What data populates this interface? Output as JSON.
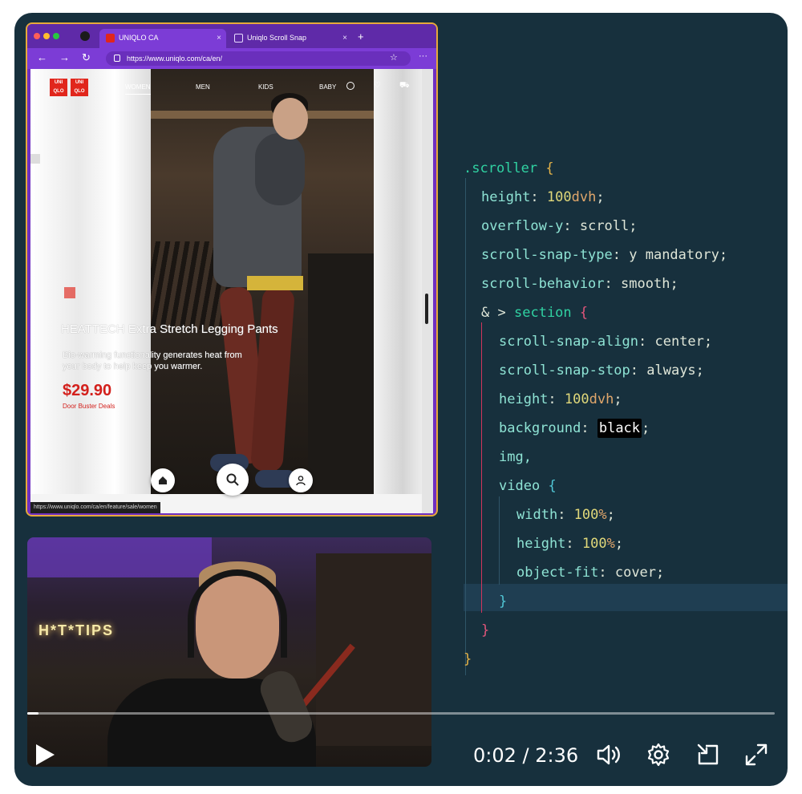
{
  "video": {
    "current_time": "0:02",
    "duration": "2:36",
    "time_separator": "/",
    "progress_fraction": 0.015
  },
  "browser": {
    "tabs": [
      {
        "label": "UNIQLO CA",
        "active": true
      },
      {
        "label": "Uniqlo Scroll Snap",
        "active": false
      }
    ],
    "url": "https://www.uniqlo.com/ca/en/",
    "status_url": "https://www.uniqlo.com/ca/en/feature/sale/women"
  },
  "site": {
    "logo_top": "UNI",
    "logo_bottom": "QLO",
    "nav": [
      "WOMEN",
      "MEN",
      "KIDS",
      "BABY"
    ],
    "product_title": "HEATTECH Extra Stretch Legging Pants",
    "product_desc": "Bio-warming functionality generates heat from your body to help keep you warmer.",
    "price": "$29.90",
    "deal": "Door Buster Deals"
  },
  "webcam": {
    "neon_sign": "H*T*TIPS"
  },
  "code": {
    "l1_sel": ".scroller",
    "l1_brace": "{",
    "l2_prop": "height",
    "l2_num": "100",
    "l2_unit": "dvh",
    "l3_prop": "overflow-y",
    "l3_val": "scroll",
    "l4_prop": "scroll-snap-type",
    "l4_val": "y mandatory",
    "l5_prop": "scroll-behavior",
    "l5_val": "smooth",
    "l6_amp": "&",
    "l6_gt": ">",
    "l6_sel": "section",
    "l6_brace": "{",
    "l7_prop": "scroll-snap-align",
    "l7_val": "center",
    "l8_prop": "scroll-snap-stop",
    "l8_val": "always",
    "l9_prop": "height",
    "l9_num": "100",
    "l9_unit": "dvh",
    "l10_prop": "background",
    "l10_val": "black",
    "l11_sel": "img,",
    "l12_sel": "video",
    "l12_brace": "{",
    "l13_prop": "width",
    "l13_num": "100",
    "l13_unit": "%",
    "l14_prop": "height",
    "l14_num": "100",
    "l14_unit": "%",
    "l15_prop": "object-fit",
    "l15_val": "cover",
    "l16_brace": "}",
    "l17_brace": "}",
    "l18_brace": "}"
  },
  "colors": {
    "player_bg": "#17303d",
    "browser_accent": "#6f2fc0",
    "price_red": "#d3201c"
  }
}
